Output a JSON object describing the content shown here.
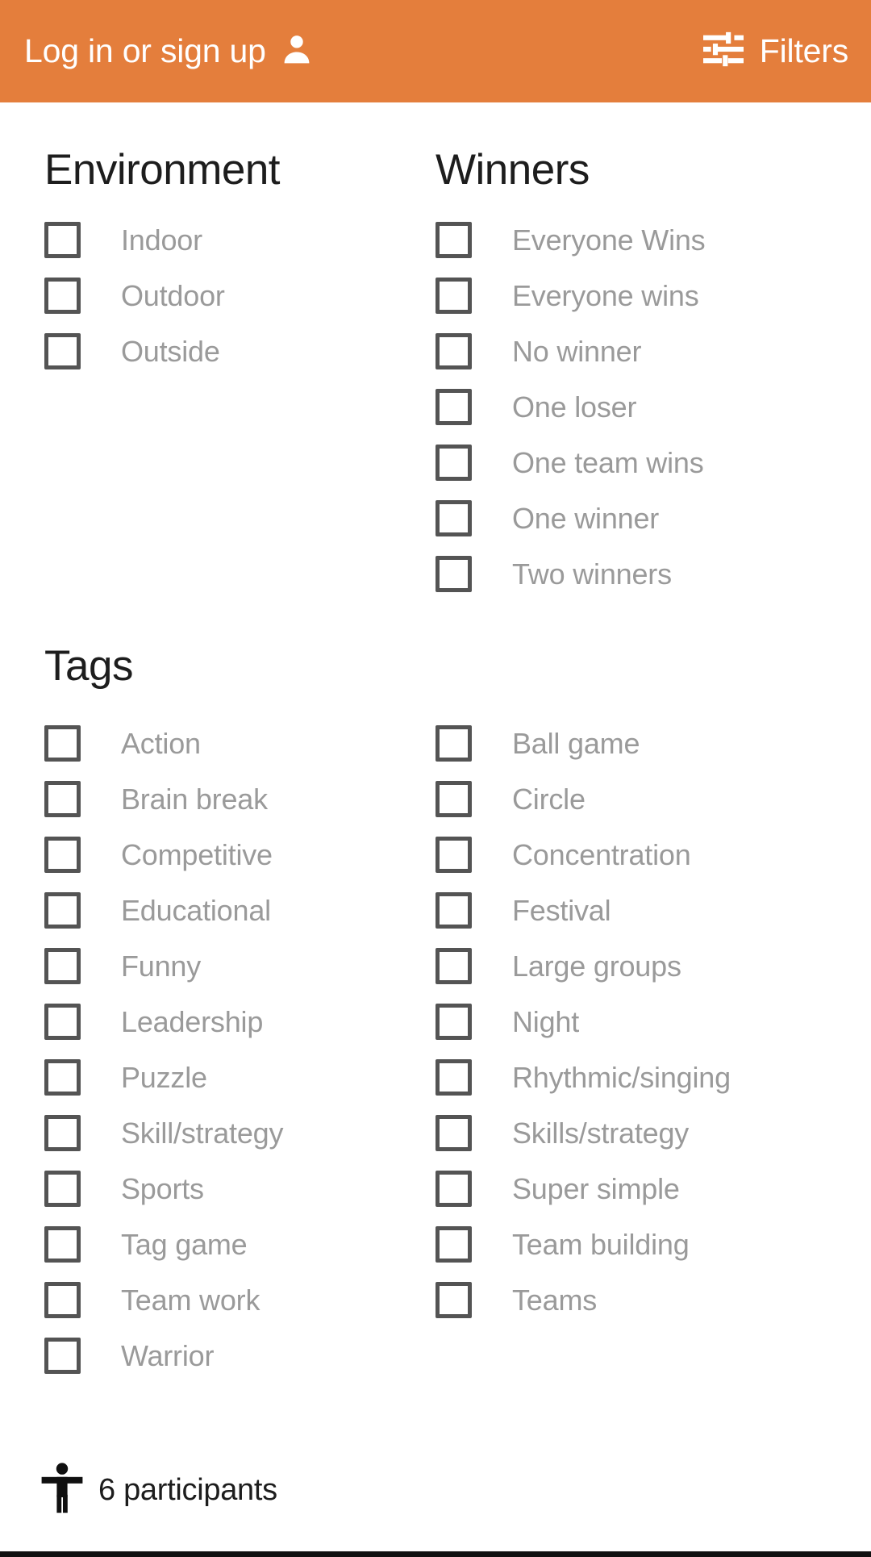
{
  "colors": {
    "header_background": "#e47e3c",
    "header_text": "#ffffff",
    "section_title": "#1d1d1d",
    "option_label": "#9a9a9a",
    "checkbox_border": "#545454",
    "page_background": "#ffffff",
    "footer_rule": "#101010"
  },
  "header": {
    "login_label": "Log in or sign up",
    "person_icon": "person-icon",
    "filters_label": "Filters",
    "tune_icon": "tune-sliders-icon"
  },
  "environment": {
    "title": "Environment",
    "options": [
      {
        "label": "Indoor",
        "checked": false
      },
      {
        "label": "Outdoor",
        "checked": false
      },
      {
        "label": "Outside",
        "checked": false
      }
    ]
  },
  "winners": {
    "title": "Winners",
    "options": [
      {
        "label": "Everyone Wins",
        "checked": false
      },
      {
        "label": "Everyone wins",
        "checked": false
      },
      {
        "label": "No winner",
        "checked": false
      },
      {
        "label": "One loser",
        "checked": false
      },
      {
        "label": "One team wins",
        "checked": false
      },
      {
        "label": "One winner",
        "checked": false
      },
      {
        "label": "Two winners",
        "checked": false
      }
    ]
  },
  "tags": {
    "title": "Tags",
    "left_options": [
      {
        "label": "Action",
        "checked": false
      },
      {
        "label": "Brain break",
        "checked": false
      },
      {
        "label": "Competitive",
        "checked": false
      },
      {
        "label": "Educational",
        "checked": false
      },
      {
        "label": "Funny",
        "checked": false
      },
      {
        "label": "Leadership",
        "checked": false
      },
      {
        "label": "Puzzle",
        "checked": false
      },
      {
        "label": "Skill/strategy",
        "checked": false
      },
      {
        "label": "Sports",
        "checked": false
      },
      {
        "label": "Tag game",
        "checked": false
      },
      {
        "label": "Team work",
        "checked": false
      },
      {
        "label": "Warrior",
        "checked": false
      }
    ],
    "right_options": [
      {
        "label": "Ball game",
        "checked": false
      },
      {
        "label": "Circle",
        "checked": false
      },
      {
        "label": "Concentration",
        "checked": false
      },
      {
        "label": "Festival",
        "checked": false
      },
      {
        "label": "Large groups",
        "checked": false
      },
      {
        "label": "Night",
        "checked": false
      },
      {
        "label": "Rhythmic/singing",
        "checked": false
      },
      {
        "label": "Skills/strategy",
        "checked": false
      },
      {
        "label": "Super simple",
        "checked": false
      },
      {
        "label": "Team building",
        "checked": false
      },
      {
        "label": "Teams",
        "checked": false
      }
    ]
  },
  "footer": {
    "accessibility_icon": "accessibility-person-icon",
    "participants_label": "6 participants"
  }
}
